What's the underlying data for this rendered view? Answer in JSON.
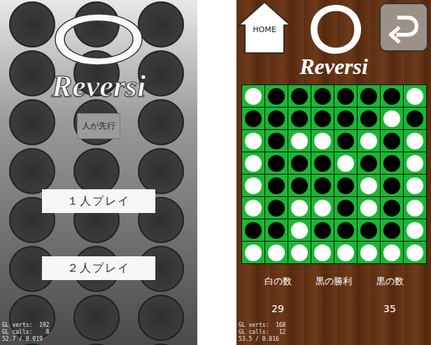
{
  "title_screen": {
    "logo": {
      "text": "Reversi"
    },
    "turn_button": {
      "label": "人が先行"
    },
    "menu_buttons": [
      {
        "label": "１人プレイ"
      },
      {
        "label": "２人プレイ"
      }
    ],
    "debug": [
      "GL verts:  192",
      "GL calls:    8",
      "52.7 / 0.019"
    ]
  },
  "game_screen": {
    "home_button": {
      "label": "HOME"
    },
    "logo": {
      "text": "Reversi"
    },
    "board": {
      "rows": [
        [
          "white",
          "black",
          "black",
          "black",
          "black",
          "black",
          "black",
          "white"
        ],
        [
          "black",
          "black",
          "black",
          "black",
          "black",
          "black",
          "white",
          "black"
        ],
        [
          "white",
          "black",
          "white",
          "white",
          "black",
          "white",
          "black",
          "white"
        ],
        [
          "white",
          "black",
          "black",
          "black",
          "white",
          "black",
          "black",
          "white"
        ],
        [
          "white",
          "black",
          "black",
          "black",
          "black",
          "white",
          "black",
          "white"
        ],
        [
          "white",
          "black",
          "white",
          "white",
          "black",
          "white",
          "black",
          "white"
        ],
        [
          "black",
          "black",
          "white",
          "black",
          "black",
          "black",
          "black",
          "white"
        ],
        [
          "white",
          "white",
          "white",
          "white",
          "white",
          "white",
          "white",
          "white"
        ]
      ]
    },
    "scores": [
      {
        "label": "白の数",
        "value": "29"
      },
      {
        "label": "黒の勝利"
      },
      {
        "label": "黒の数",
        "value": "35"
      }
    ],
    "debug": [
      "GL verts:  168",
      "GL calls:   12",
      "53.5 / 0.016"
    ]
  }
}
